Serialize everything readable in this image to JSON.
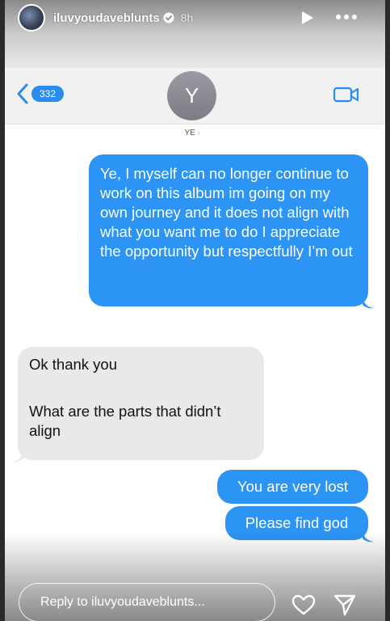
{
  "story": {
    "username": "iluvyoudaveblunts",
    "time": "8h",
    "reply_placeholder": "Reply to iluvyoudaveblunts...",
    "icons": [
      "avatar",
      "verified-icon",
      "play-icon",
      "more-icon",
      "heart-icon",
      "send-icon"
    ]
  },
  "imessage": {
    "back_count": "332",
    "contact_initial": "Y",
    "contact_name": "YE",
    "icons": [
      "back-chevron-icon",
      "video-call-icon"
    ],
    "messages": [
      {
        "direction": "outgoing",
        "text": "Ye, I myself can no longer continue to work on this album im going on my own journey and it does not align with what you want me to do I appreciate the opportunity but respectfully I’m out"
      },
      {
        "direction": "incoming",
        "text_1": "Ok thank you",
        "text_2": "What are the parts that didn’t align"
      },
      {
        "direction": "outgoing",
        "text": "You are very lost"
      },
      {
        "direction": "outgoing",
        "text": "Please find god"
      }
    ]
  },
  "colors": {
    "outgoing_bubble": "#2b94f5",
    "incoming_bubble": "#e9e9eb",
    "accent": "#2b8cf0"
  }
}
